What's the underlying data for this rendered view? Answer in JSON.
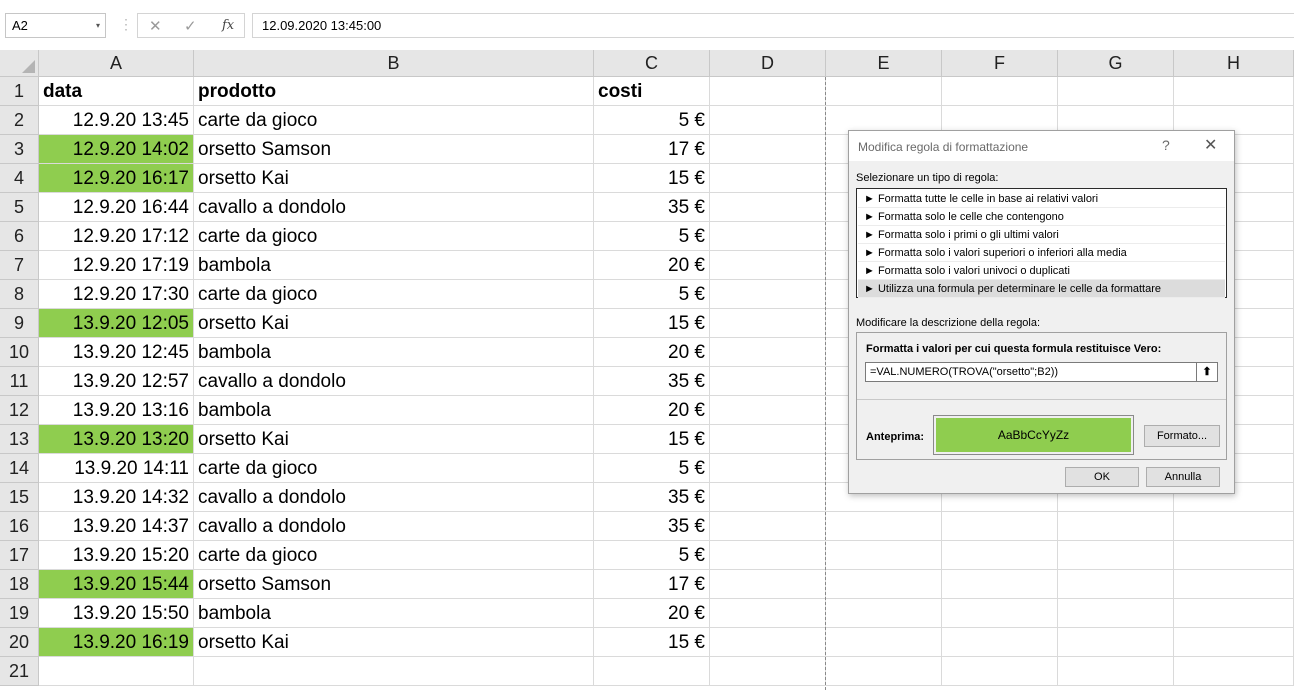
{
  "formula_bar": {
    "name_box": "A2",
    "name_box_dropdown": "▾",
    "separator": "⋮",
    "cancel": "✕",
    "enter": "✓",
    "fx": "fx",
    "content": "12.09.2020  13:45:00"
  },
  "sheet": {
    "columns": [
      "A",
      "B",
      "C",
      "D",
      "E",
      "F",
      "G",
      "H"
    ],
    "rows": [
      "1",
      "2",
      "3",
      "4",
      "5",
      "6",
      "7",
      "8",
      "9",
      "10",
      "11",
      "12",
      "13",
      "14",
      "15",
      "16",
      "17",
      "18",
      "19",
      "20",
      "21"
    ],
    "header": {
      "a": "data",
      "b": "prodotto",
      "c": "costi"
    },
    "data": [
      {
        "a": "12.9.20 13:45",
        "b": "carte da gioco",
        "c": "5 €",
        "hl": false
      },
      {
        "a": "12.9.20 14:02",
        "b": "orsetto Samson",
        "c": "17 €",
        "hl": true
      },
      {
        "a": "12.9.20 16:17",
        "b": "orsetto Kai",
        "c": "15 €",
        "hl": true
      },
      {
        "a": "12.9.20 16:44",
        "b": "cavallo a dondolo",
        "c": "35 €",
        "hl": false
      },
      {
        "a": "12.9.20 17:12",
        "b": "carte da gioco",
        "c": "5 €",
        "hl": false
      },
      {
        "a": "12.9.20 17:19",
        "b": "bambola",
        "c": "20 €",
        "hl": false
      },
      {
        "a": "12.9.20 17:30",
        "b": "carte da gioco",
        "c": "5 €",
        "hl": false
      },
      {
        "a": "13.9.20 12:05",
        "b": "orsetto Kai",
        "c": "15 €",
        "hl": true
      },
      {
        "a": "13.9.20 12:45",
        "b": "bambola",
        "c": "20 €",
        "hl": false
      },
      {
        "a": "13.9.20 12:57",
        "b": "cavallo a dondolo",
        "c": "35 €",
        "hl": false
      },
      {
        "a": "13.9.20 13:16",
        "b": "bambola",
        "c": "20 €",
        "hl": false
      },
      {
        "a": "13.9.20 13:20",
        "b": "orsetto Kai",
        "c": "15 €",
        "hl": true
      },
      {
        "a": "13.9.20 14:11",
        "b": "carte da gioco",
        "c": "5 €",
        "hl": false
      },
      {
        "a": "13.9.20 14:32",
        "b": "cavallo a dondolo",
        "c": "35 €",
        "hl": false
      },
      {
        "a": "13.9.20 14:37",
        "b": "cavallo a dondolo",
        "c": "35 €",
        "hl": false
      },
      {
        "a": "13.9.20 15:20",
        "b": "carte da gioco",
        "c": "5 €",
        "hl": false
      },
      {
        "a": "13.9.20 15:44",
        "b": "orsetto Samson",
        "c": "17 €",
        "hl": true
      },
      {
        "a": "13.9.20 15:50",
        "b": "bambola",
        "c": "20 €",
        "hl": false
      },
      {
        "a": "13.9.20 16:19",
        "b": "orsetto Kai",
        "c": "15 €",
        "hl": true
      }
    ],
    "highlight_color": "#8fcd4f"
  },
  "dialog": {
    "title": "Modifica regola di formattazione",
    "help": "?",
    "close": "✕",
    "select_label": "Selezionare un tipo di regola:",
    "rule_types": [
      "► Formatta tutte le celle in base ai relativi valori",
      "► Formatta solo le celle che contengono",
      "► Formatta solo i primi o gli ultimi valori",
      "► Formatta solo i valori superiori o inferiori alla media",
      "► Formatta solo i valori univoci o duplicati",
      "► Utilizza una formula per determinare le celle da formattare"
    ],
    "edit_label": "Modificare la descrizione della regola:",
    "formula_title": "Formatta i valori per cui questa formula restituisce Vero:",
    "formula": "=VAL.NUMERO(TROVA(\"orsetto\";B2))",
    "collapse": "⬆",
    "preview_label": "Anteprima:",
    "preview_text": "AaBbCcYyZz",
    "format_button": "Formato...",
    "ok": "OK",
    "cancel": "Annulla"
  }
}
